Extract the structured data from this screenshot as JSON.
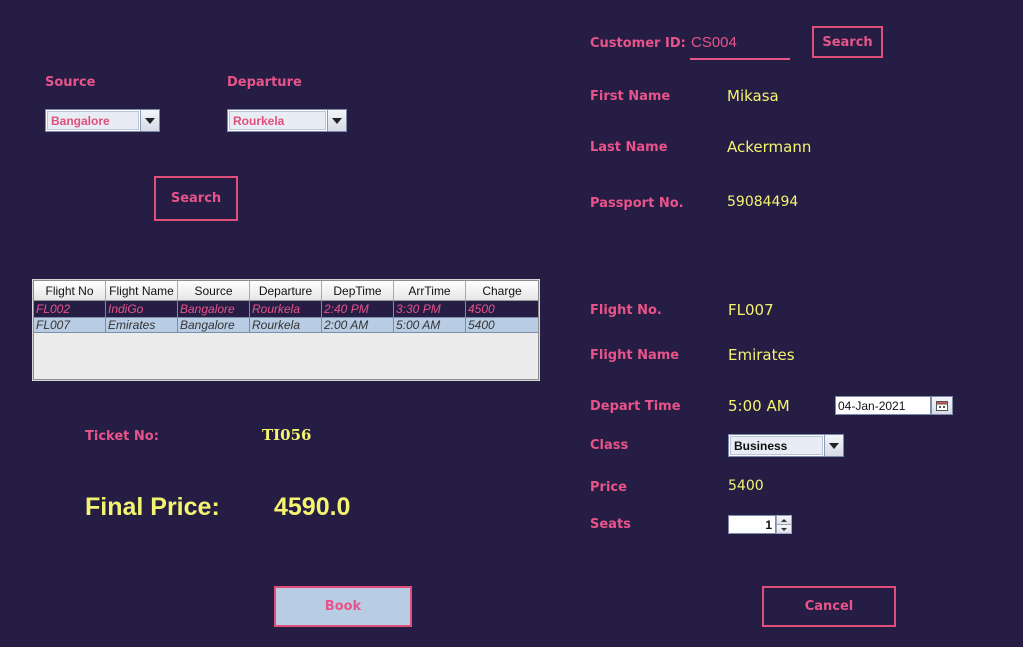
{
  "search_panel": {
    "source_label": "Source",
    "departure_label": "Departure",
    "source_value": "Bangalore",
    "departure_value": "Rourkela",
    "search_button": "Search"
  },
  "flights_table": {
    "columns": [
      "Flight No",
      "Flight Name",
      "Source",
      "Departure",
      "DepTime",
      "ArrTime",
      "Charge"
    ],
    "rows": [
      [
        "FL002",
        "IndiGo",
        "Bangalore",
        "Rourkela",
        "2:40 PM",
        "3:30 PM",
        "4500"
      ],
      [
        "FL007",
        "Emirates",
        "Bangalore",
        "Rourkela",
        "2:00 AM",
        "5:00 AM",
        "5400"
      ]
    ]
  },
  "ticket": {
    "ticket_label": "Ticket No:",
    "ticket_value": "TI056",
    "final_price_label": "Final Price:",
    "final_price_value": "4590.0"
  },
  "customer": {
    "customer_id_label": "Customer ID:",
    "customer_id_value": "CS004",
    "search_button": "Search",
    "first_name_label": "First Name",
    "first_name_value": "Mikasa",
    "last_name_label": "Last Name",
    "last_name_value": "Ackermann",
    "passport_label": "Passport No.",
    "passport_value": "59084494"
  },
  "flight_details": {
    "flight_no_label": "Flight No.",
    "flight_no_value": "FL007",
    "flight_name_label": "Flight Name",
    "flight_name_value": "Emirates",
    "depart_time_label": "Depart Time",
    "depart_time_value": "5:00 AM",
    "date_value": "04-Jan-2021",
    "class_label": "Class",
    "class_value": "Business",
    "price_label": "Price",
    "price_value": "5400",
    "seats_label": "Seats",
    "seats_value": "1"
  },
  "actions": {
    "book_button": "Book",
    "cancel_button": "Cancel"
  },
  "colors": {
    "background": "#261d45",
    "label": "#e8548a",
    "value": "#f4f46f",
    "book_button_fill": "#b8cde4"
  }
}
